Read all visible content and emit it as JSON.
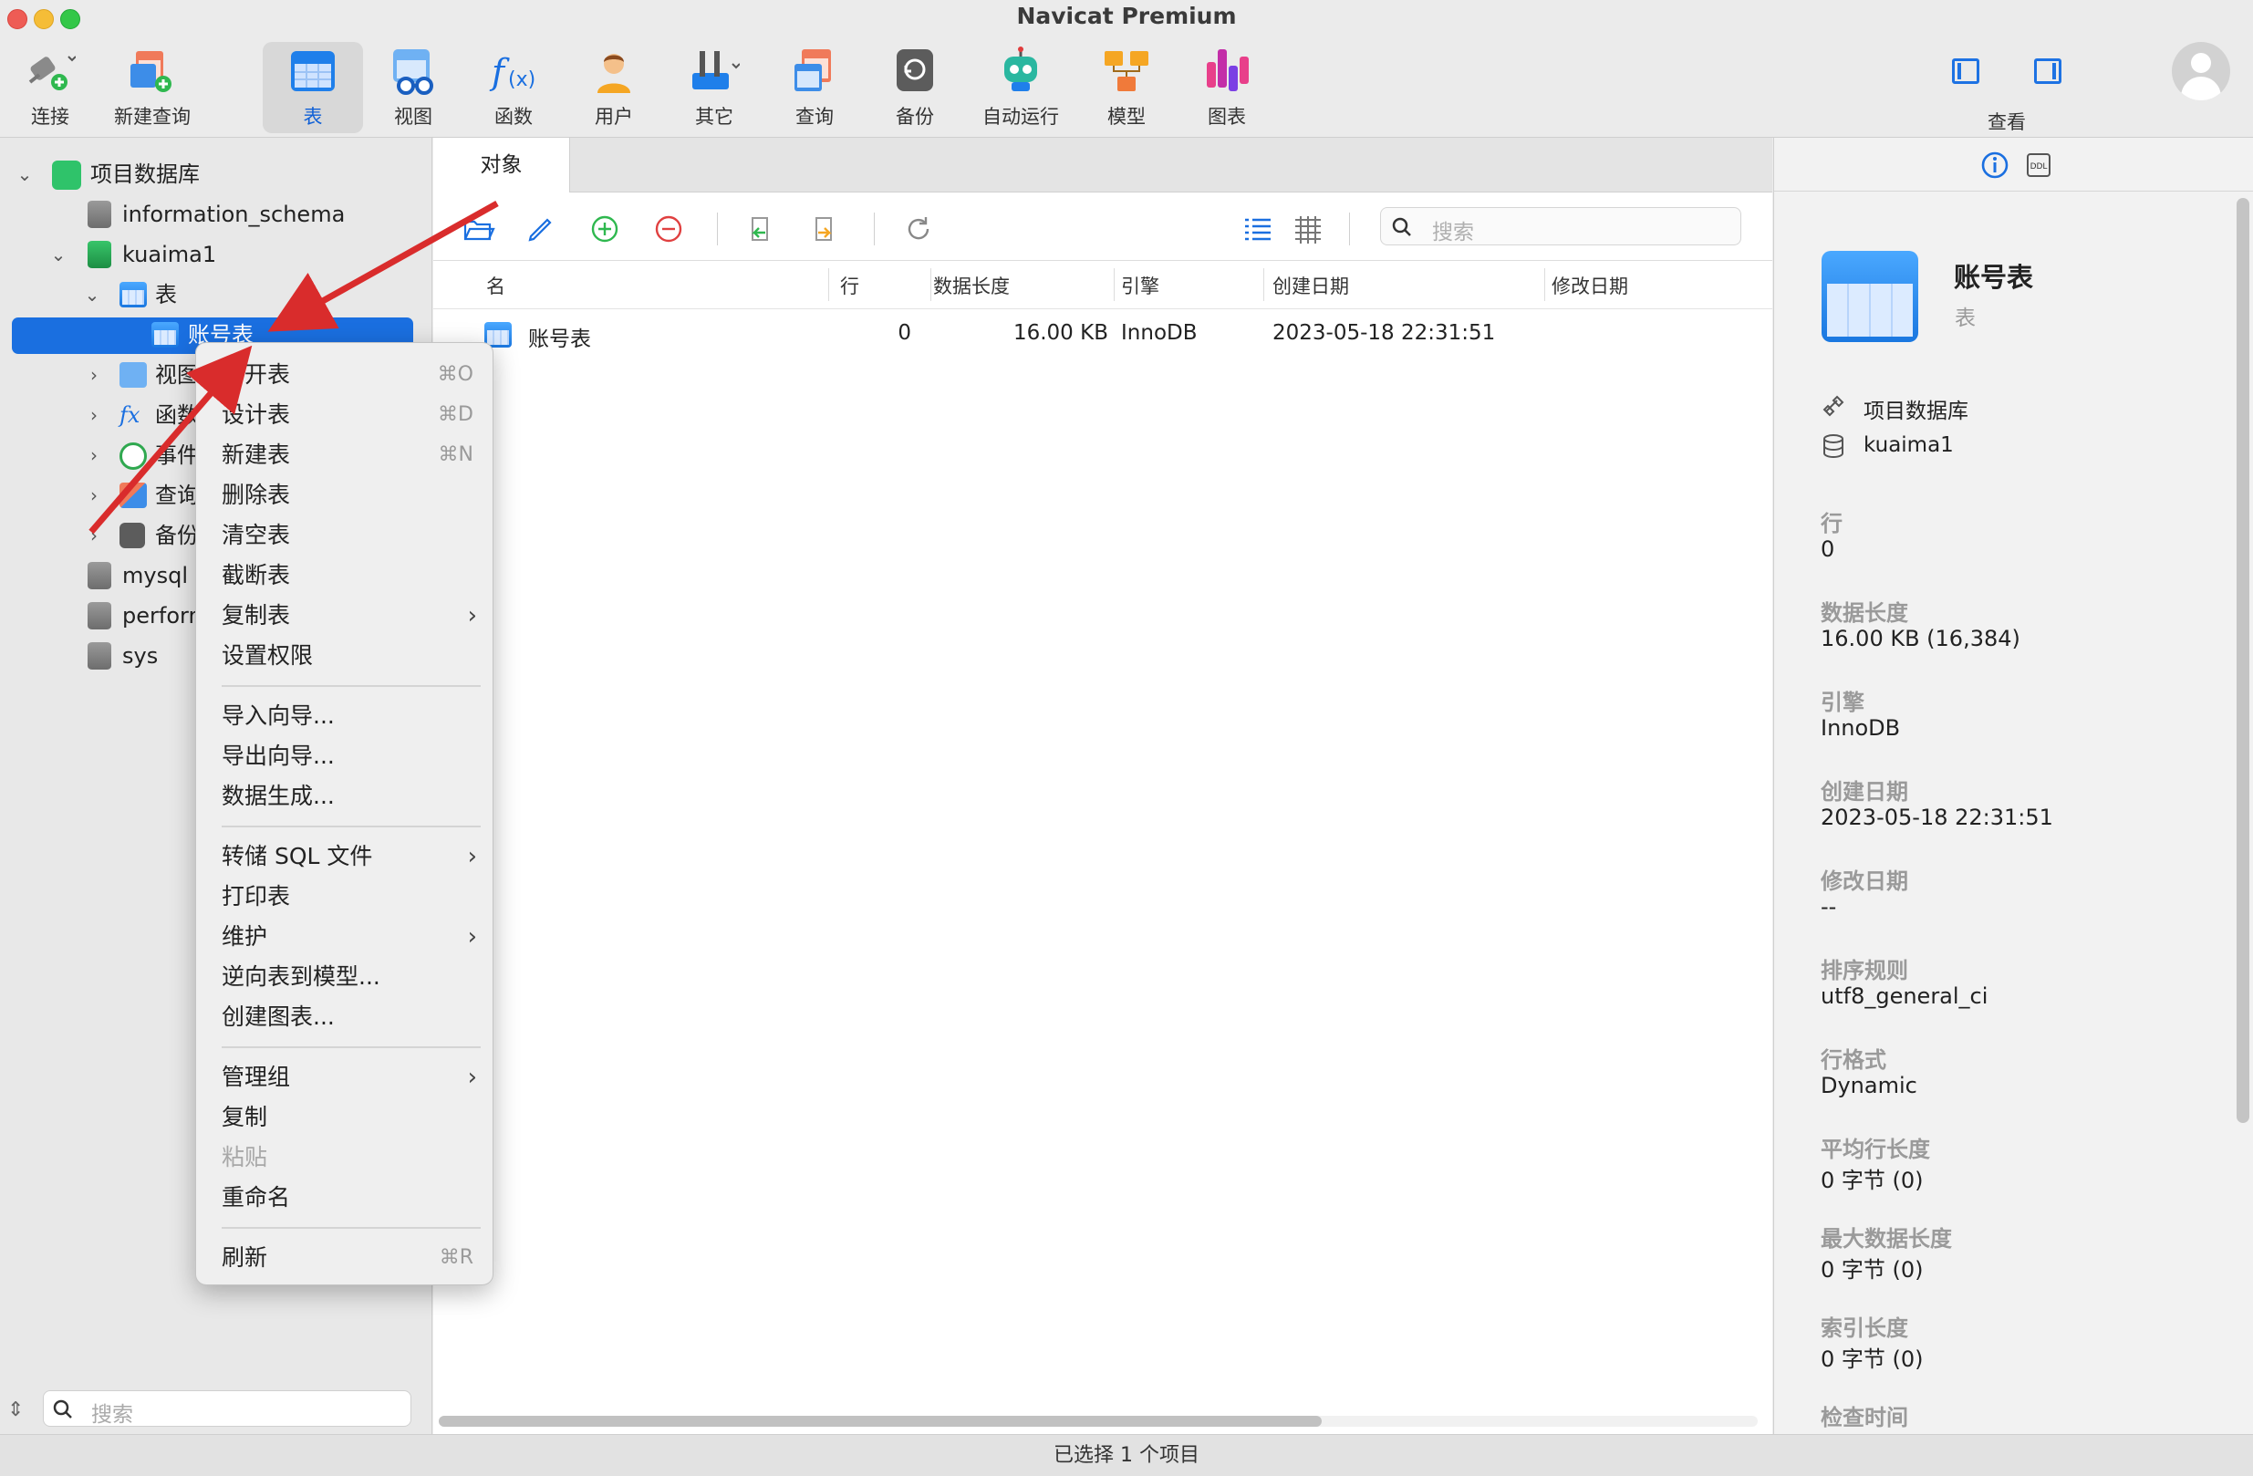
{
  "window": {
    "title": "Navicat Premium"
  },
  "toolbar": {
    "left": [
      {
        "icon": "connect-icon",
        "label": "连接"
      },
      {
        "icon": "new-query-icon",
        "label": "新建查询"
      }
    ],
    "main": [
      {
        "icon": "table-icon",
        "label": "表",
        "active": true
      },
      {
        "icon": "view-icon",
        "label": "视图"
      },
      {
        "icon": "function-icon",
        "label": "函数"
      },
      {
        "icon": "user-icon",
        "label": "用户"
      },
      {
        "icon": "tools-icon",
        "label": "其它"
      },
      {
        "icon": "query-icon",
        "label": "查询"
      },
      {
        "icon": "backup-icon",
        "label": "备份"
      },
      {
        "icon": "robot-icon",
        "label": "自动运行"
      },
      {
        "icon": "model-icon",
        "label": "模型"
      },
      {
        "icon": "chart-icon",
        "label": "图表"
      }
    ],
    "view_label": "查看"
  },
  "sidebar": {
    "tree": {
      "connection": "项目数据库",
      "items": {
        "information_schema": "information_schema",
        "kuaima1": "kuaima1",
        "tables_group": "表",
        "selected_table": "账号表",
        "views": "视图",
        "functions": "函数",
        "events": "事件",
        "queries": "查询",
        "backups": "备份",
        "mysql": "mysql",
        "performance_schema": "perform",
        "sys": "sys"
      }
    },
    "search_placeholder": "搜索"
  },
  "objects": {
    "tab_label": "对象",
    "search_placeholder": "搜索",
    "columns": [
      "名",
      "行",
      "数据长度",
      "引擎",
      "创建日期",
      "修改日期"
    ],
    "rows": [
      {
        "name": "账号表",
        "rows": "0",
        "data_length": "16.00 KB",
        "engine": "InnoDB",
        "created": "2023-05-18 22:31:51",
        "modified": ""
      }
    ]
  },
  "context_menu": {
    "items": [
      {
        "label": "打开表",
        "shortcut": "⌘O"
      },
      {
        "label": "设计表",
        "shortcut": "⌘D"
      },
      {
        "label": "新建表",
        "shortcut": "⌘N"
      },
      {
        "label": "删除表"
      },
      {
        "label": "清空表"
      },
      {
        "label": "截断表"
      },
      {
        "label": "复制表",
        "submenu": true
      },
      {
        "label": "设置权限"
      },
      {
        "label": "导入向导..."
      },
      {
        "label": "导出向导..."
      },
      {
        "label": "数据生成..."
      },
      {
        "label": "转储 SQL 文件",
        "submenu": true
      },
      {
        "label": "打印表"
      },
      {
        "label": "维护",
        "submenu": true
      },
      {
        "label": "逆向表到模型..."
      },
      {
        "label": "创建图表..."
      },
      {
        "label": "管理组",
        "submenu": true
      },
      {
        "label": "复制"
      },
      {
        "label": "粘贴",
        "disabled": true
      },
      {
        "label": "重命名"
      },
      {
        "label": "刷新",
        "shortcut": "⌘R"
      }
    ],
    "submenu_arrow": "›"
  },
  "info_panel": {
    "title": "账号表",
    "subtitle": "表",
    "connection": "项目数据库",
    "database": "kuaima1",
    "props": [
      {
        "label": "行",
        "value": "0"
      },
      {
        "label": "数据长度",
        "value": "16.00 KB (16,384)"
      },
      {
        "label": "引擎",
        "value": "InnoDB"
      },
      {
        "label": "创建日期",
        "value": "2023-05-18 22:31:51"
      },
      {
        "label": "修改日期",
        "value": "--"
      },
      {
        "label": "排序规则",
        "value": "utf8_general_ci"
      },
      {
        "label": "行格式",
        "value": "Dynamic"
      },
      {
        "label": "平均行长度",
        "value": "0 字节 (0)"
      },
      {
        "label": "最大数据长度",
        "value": "0 字节 (0)"
      },
      {
        "label": "索引长度",
        "value": "0 字节 (0)"
      },
      {
        "label": "检查时间",
        "value": ""
      }
    ]
  },
  "status": {
    "text": "已选择 1 个项目"
  },
  "colors": {
    "accent": "#1a6fe0",
    "annotation_arrow": "#d92c2c"
  }
}
